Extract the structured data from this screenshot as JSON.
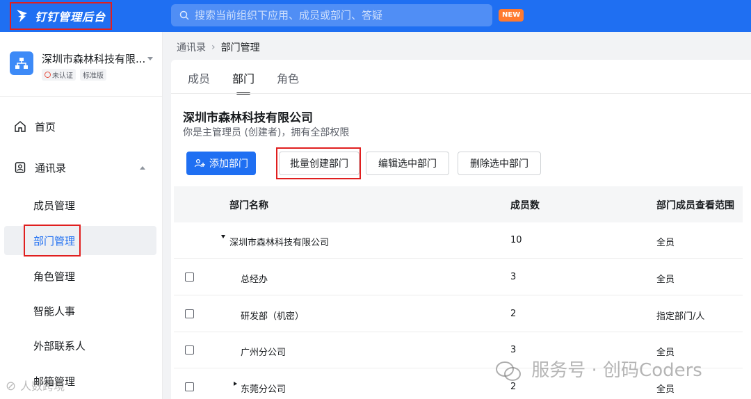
{
  "topbar": {
    "brand_title": "钉钉管理后台",
    "search_placeholder": "搜索当前组织下应用、成员或部门、答疑",
    "new_badge": "NEW"
  },
  "org": {
    "name": "深圳市森林科技有限...",
    "tags": [
      "未认证",
      "标准版"
    ]
  },
  "nav": {
    "home": "首页",
    "contacts": "通讯录",
    "sub_items": [
      "成员管理",
      "部门管理",
      "角色管理",
      "智能人事",
      "外部联系人",
      "邮箱管理"
    ]
  },
  "breadcrumb": {
    "parent": "通讯录",
    "current": "部门管理"
  },
  "tabs": [
    "成员",
    "部门",
    "角色"
  ],
  "main": {
    "company": "深圳市森林科技有限公司",
    "description": "你是主管理员 (创建者)，拥有全部权限"
  },
  "buttons": {
    "add": "添加部门",
    "batch_create": "批量创建部门",
    "edit_selected": "编辑选中部门",
    "delete_selected": "删除选中部门"
  },
  "table": {
    "headers": [
      "部门名称",
      "成员数",
      "部门成员查看范围"
    ],
    "rows": [
      {
        "name": "深圳市森林科技有限公司",
        "count": "10",
        "scope": "全员"
      },
      {
        "name": "总经办",
        "count": "3",
        "scope": "全员"
      },
      {
        "name": "研发部（机密）",
        "count": "2",
        "scope": "指定部门/人"
      },
      {
        "name": "广州分公司",
        "count": "3",
        "scope": "全员"
      },
      {
        "name": "东莞分公司",
        "count": "2",
        "scope": "全员"
      }
    ]
  },
  "watermarks": {
    "right": "服务号 · 创码Coders",
    "left": "人数跨境"
  },
  "colors": {
    "brand_blue": "#1f6ff2",
    "highlight_red": "#e01f1f",
    "new_orange": "#ff7a2f"
  }
}
